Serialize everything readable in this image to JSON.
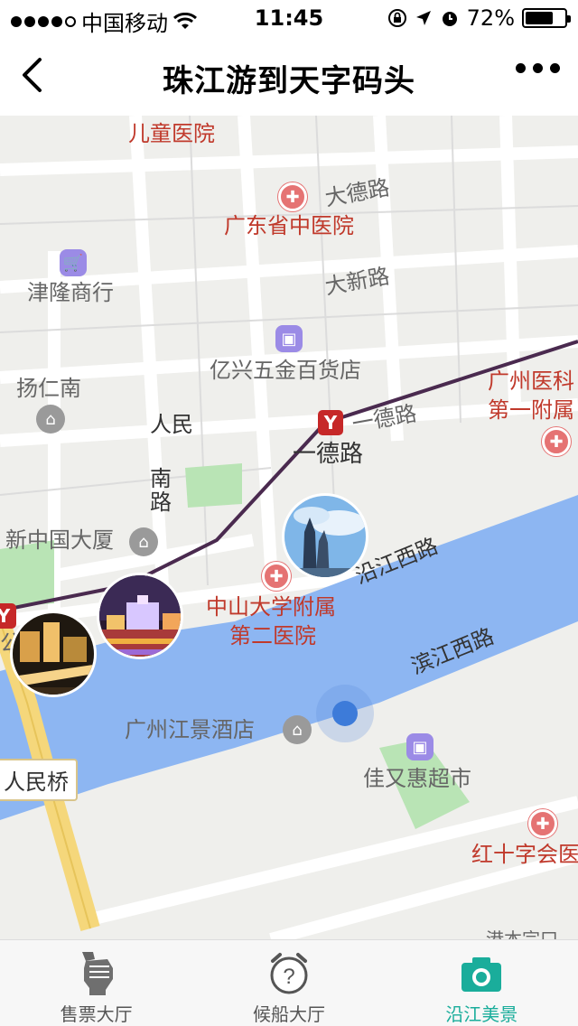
{
  "status_bar": {
    "carrier": "中国移动",
    "time": "11:45",
    "battery": "72%",
    "battery_level": 0.72
  },
  "nav": {
    "title": "珠江游到天字码头"
  },
  "map": {
    "labels": {
      "children_hospital": "儿童医院",
      "dade_road": "大德路",
      "guangdong_tcm": "广东省中医院",
      "jinlong": "津隆商行",
      "daxin_road": "大新路",
      "yixing": "亿兴五金百货店",
      "yangrennan": "扬仁南",
      "gz_medical_1": "广州医科",
      "gz_medical_2": "第一附属",
      "yide_road": "一德路",
      "yide_station": "一德路",
      "renmin_nan_1": "人民",
      "renmin_nan_2": "南",
      "renmin_nan_3": "路",
      "xinzhongguo": "新中国大厦",
      "yanjiang_xi": "沿江西路",
      "zhongshan_1": "中山大学附属",
      "zhongshan_2": "第二医院",
      "binjiang_xi": "滨江西路",
      "jiangjing_hotel": "广州江景酒店",
      "jiayouhui": "佳又惠超市",
      "red_cross": "红十字会医",
      "renmin_bridge": "人民桥",
      "partial_gong": "公",
      "partial_bottom": "港本宗口"
    }
  },
  "tabs": [
    {
      "label": "售票大厅",
      "icon": "fist-ticket-icon"
    },
    {
      "label": "候船大厅",
      "icon": "alarm-clock-question-icon"
    },
    {
      "label": "沿江美景",
      "icon": "camera-icon",
      "active": true
    }
  ],
  "colors": {
    "accent": "#1aad9b",
    "river": "#8db6f2",
    "metro_line": "#4a2a4f",
    "map_red": "#c0392b"
  }
}
